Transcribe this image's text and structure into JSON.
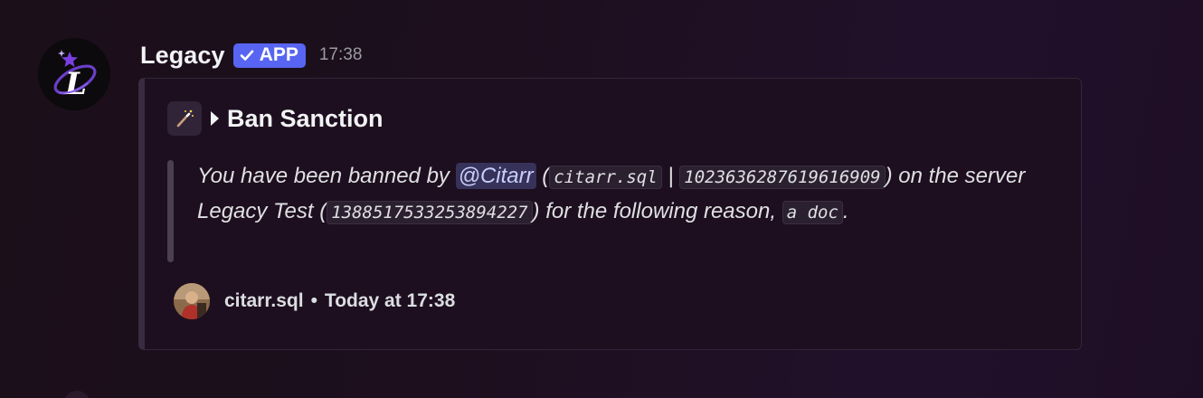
{
  "message": {
    "author": "Legacy",
    "badge": "APP",
    "time": "17:38",
    "avatar_icon": "legacy-logo-icon"
  },
  "embed": {
    "title": "Ban Sanction",
    "title_icon": "magic-wand-icon",
    "description": {
      "part1": "You have been banned by ",
      "mention": "@Citarr",
      "part2": " (",
      "username_code": "citarr.sql",
      "sep": " | ",
      "user_id_code": "1023636287619616909",
      "part3": ") on the server Legacy Test (",
      "server_id_code": "1388517533253894227",
      "part4": ") for the following reason, ",
      "reason_code": "a doc",
      "part5": "."
    },
    "footer": {
      "author": "citarr.sql",
      "separator": "•",
      "timestamp": "Today at 17:38"
    }
  },
  "colors": {
    "app_badge": "#5865f2",
    "mention_bg": "#36325a",
    "embed_bg": "#1d0f1f"
  }
}
